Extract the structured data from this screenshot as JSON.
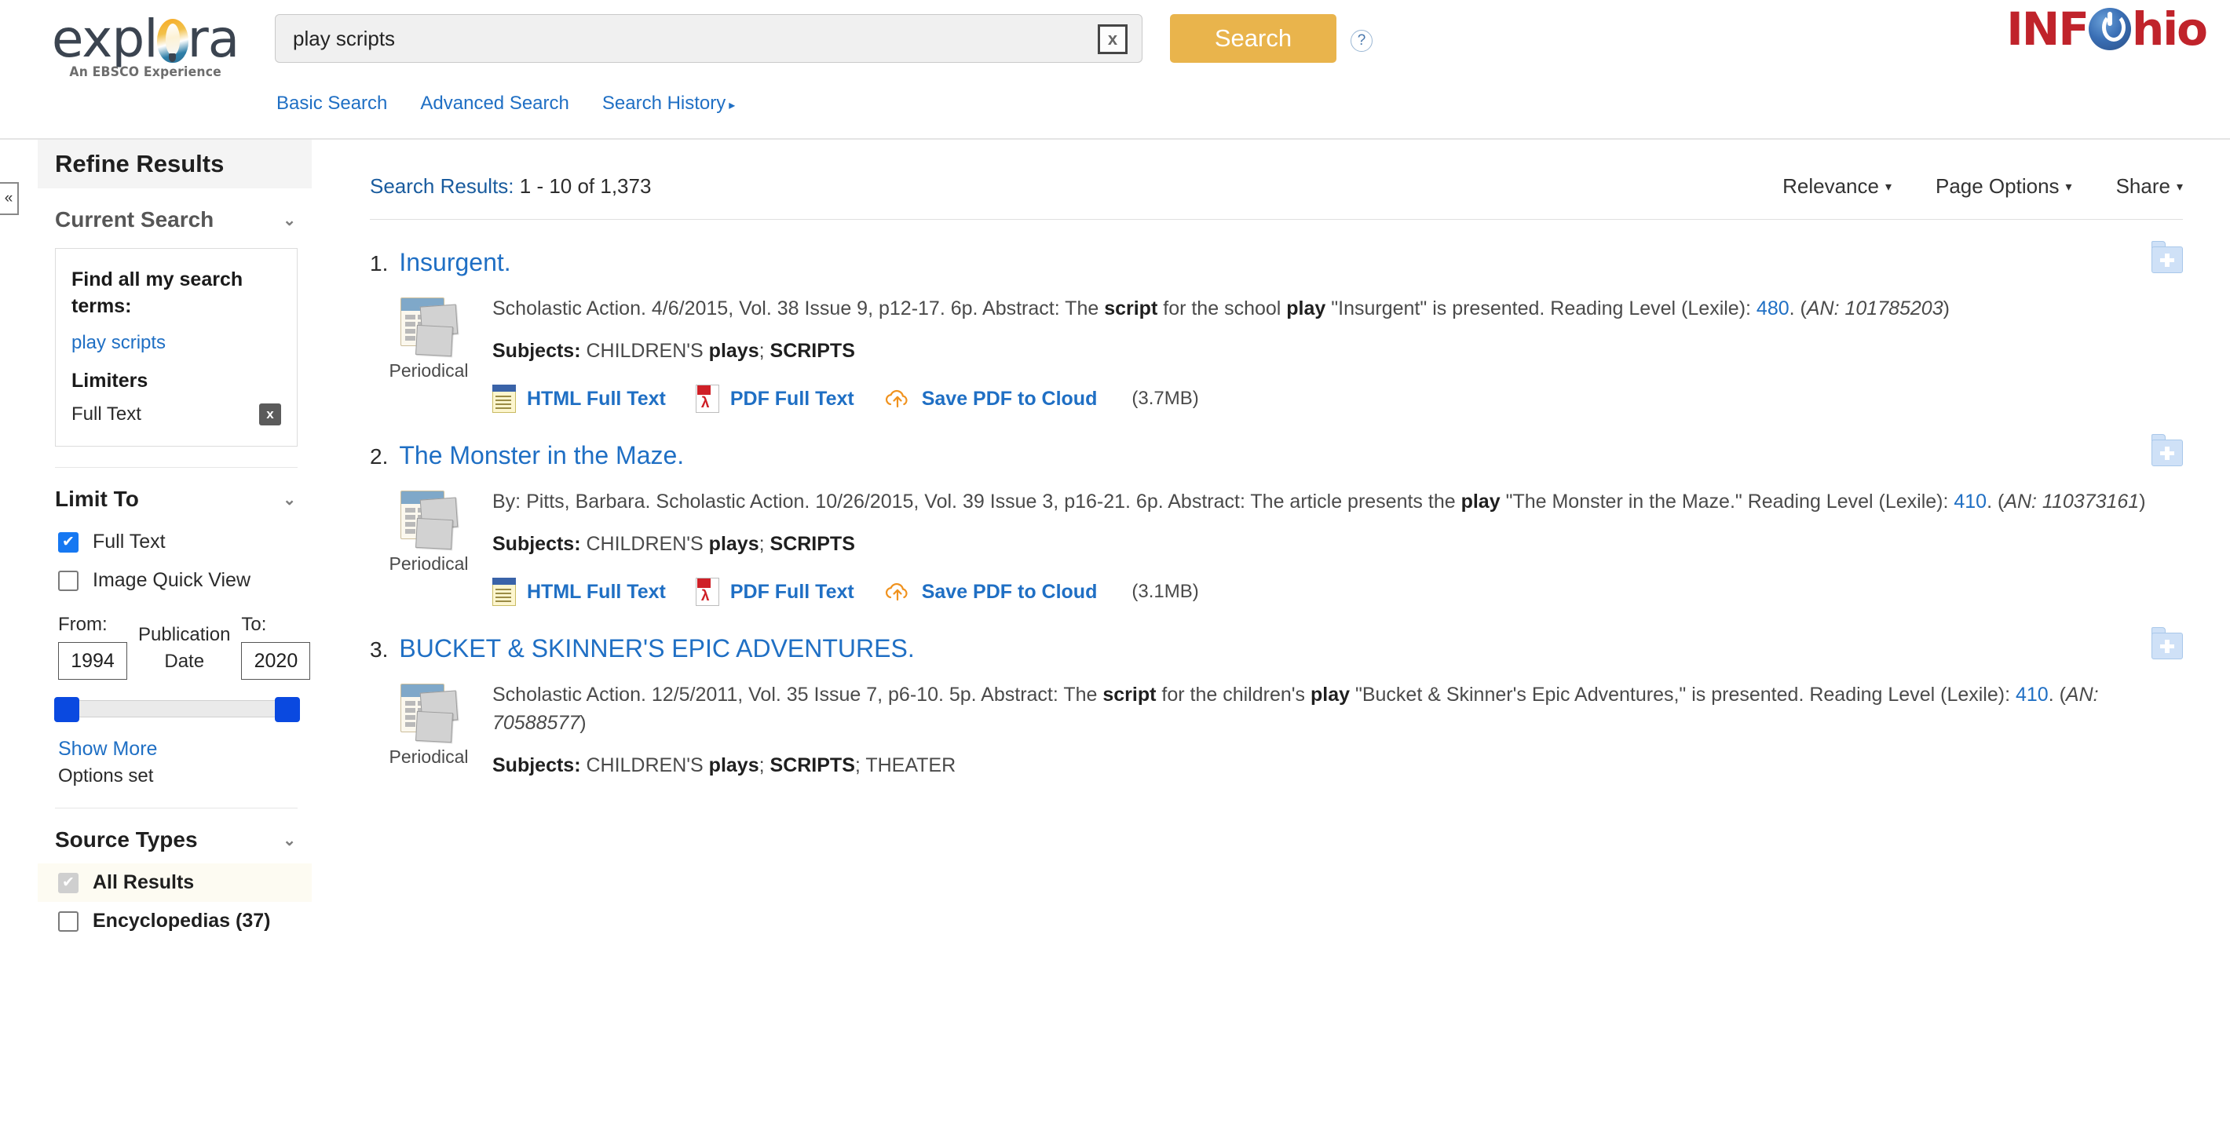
{
  "header": {
    "logo_text": "explora",
    "logo_tagline": "An EBSCO Experience",
    "search_value": "play scripts",
    "search_placeholder": "Search",
    "clear_label": "x",
    "search_button": "Search",
    "help_label": "?",
    "brand_right": "INF",
    "brand_right_2": "hio",
    "nav": [
      {
        "label": "Basic Search"
      },
      {
        "label": "Advanced Search"
      },
      {
        "label": "Search History",
        "caret": "▸"
      }
    ]
  },
  "sidebar": {
    "collapse_label": "«",
    "title": "Refine Results",
    "current_search": {
      "title": "Current Search",
      "chevron": "⌄",
      "find_all_label": "Find all my search terms:",
      "term": "play scripts",
      "limiters_label": "Limiters",
      "limiter": "Full Text",
      "remove_label": "x"
    },
    "limit_to": {
      "title": "Limit To",
      "chevron": "⌄",
      "options": [
        {
          "label": "Full Text",
          "checked": true
        },
        {
          "label": "Image Quick View",
          "checked": false
        }
      ],
      "from_label": "From:",
      "to_label": "To:",
      "from_value": "1994",
      "to_value": "2020",
      "pubdate_label": "Publication Date",
      "show_more": "Show More",
      "options_set": "Options set"
    },
    "source_types": {
      "title": "Source Types",
      "chevron": "⌄",
      "options": [
        {
          "label": "All Results",
          "checked": true,
          "highlighted": true
        },
        {
          "label": "Encyclopedias (37)",
          "checked": false,
          "highlighted": false
        }
      ]
    }
  },
  "results_toolbar": {
    "search_results_label": "Search Results:",
    "range_text": " 1 - 10 of 1,373",
    "sort": "Relevance",
    "page_options": "Page Options",
    "share": "Share",
    "caret": "▾"
  },
  "results": [
    {
      "num": "1.",
      "title": "Insurgent.",
      "thumb_caption": "Periodical",
      "abstract_pre": "Scholastic Action. 4/6/2015, Vol. 38 Issue 9, p12-17. 6p. Abstract: The ",
      "bold1": "script",
      "abstract_mid": " for the school ",
      "bold2": "play",
      "abstract_post": " \"Insurgent\" is presented. Reading Level (Lexile): ",
      "lexile": "480",
      "an_prefix": ". (",
      "an": "AN: 101785203",
      "an_suffix": ")",
      "subjects_label": "Subjects:",
      "subjects_parts": [
        {
          "text": " CHILDREN'S ",
          "bold": false
        },
        {
          "text": "plays",
          "bold": true
        },
        {
          "text": "; ",
          "bold": false
        },
        {
          "text": "SCRIPTS",
          "bold": true
        }
      ],
      "links": [
        {
          "icon": "html-icon",
          "label": "HTML Full Text"
        },
        {
          "icon": "pdf-icon",
          "label": "PDF Full Text"
        },
        {
          "icon": "cloud-upload-icon",
          "label": "Save PDF to Cloud"
        }
      ],
      "size": "(3.7MB)"
    },
    {
      "num": "2.",
      "title": "The Monster in the Maze.",
      "thumb_caption": "Periodical",
      "abstract_pre": "By: Pitts, Barbara. Scholastic Action. 10/26/2015, Vol. 39 Issue 3, p16-21. 6p. Abstract: The article presents the ",
      "bold1": "",
      "abstract_mid": "",
      "bold2": "play",
      "abstract_post": " \"The Monster in the Maze.\" Reading Level (Lexile): ",
      "lexile": "410",
      "an_prefix": ". (",
      "an": "AN: 110373161",
      "an_suffix": ")",
      "subjects_label": "Subjects:",
      "subjects_parts": [
        {
          "text": " CHILDREN'S ",
          "bold": false
        },
        {
          "text": "plays",
          "bold": true
        },
        {
          "text": "; ",
          "bold": false
        },
        {
          "text": "SCRIPTS",
          "bold": true
        }
      ],
      "links": [
        {
          "icon": "html-icon",
          "label": "HTML Full Text"
        },
        {
          "icon": "pdf-icon",
          "label": "PDF Full Text"
        },
        {
          "icon": "cloud-upload-icon",
          "label": "Save PDF to Cloud"
        }
      ],
      "size": "(3.1MB)"
    },
    {
      "num": "3.",
      "title": "BUCKET & SKINNER'S EPIC ADVENTURES.",
      "thumb_caption": "Periodical",
      "abstract_pre": "Scholastic Action. 12/5/2011, Vol. 35 Issue 7, p6-10. 5p. Abstract: The ",
      "bold1": "script",
      "abstract_mid": " for the children's ",
      "bold2": "play",
      "abstract_post": " \"Bucket & Skinner's Epic Adventures,\" is presented. Reading Level (Lexile): ",
      "lexile": "410",
      "an_prefix": ". (",
      "an": "AN: 70588577",
      "an_suffix": ")",
      "subjects_label": "Subjects:",
      "subjects_parts": [
        {
          "text": " CHILDREN'S ",
          "bold": false
        },
        {
          "text": "plays",
          "bold": true
        },
        {
          "text": "; ",
          "bold": false
        },
        {
          "text": "SCRIPTS",
          "bold": true
        },
        {
          "text": "; THEATER",
          "bold": false
        }
      ],
      "links": [],
      "size": ""
    }
  ],
  "colors": {
    "link_blue": "#1f6fc4",
    "search_button": "#e9b44c",
    "brand_red": "#c0232b",
    "checkbox_blue": "#1678f2",
    "slider_blue": "#0a49e0"
  }
}
